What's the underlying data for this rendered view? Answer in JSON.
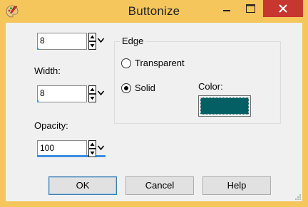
{
  "window": {
    "title": "Buttonize",
    "icons": {
      "app": "paint-palette-icon",
      "minimize": "minimize-icon",
      "maximize": "maximize-icon",
      "close": "close-icon"
    }
  },
  "top_field": {
    "value": "8",
    "fill_fraction": 0.02
  },
  "width_field": {
    "label": "Width:",
    "value": "8",
    "fill_fraction": 0.02
  },
  "opacity_field": {
    "label": "Opacity:",
    "value": "100",
    "fill_fraction": 1.0
  },
  "edge": {
    "group_label": "Edge",
    "options": [
      {
        "label": "Transparent",
        "selected": false
      },
      {
        "label": "Solid",
        "selected": true
      }
    ],
    "color_label": "Color:",
    "color": "#035f63"
  },
  "buttons": {
    "ok": "OK",
    "cancel": "Cancel",
    "help": "Help"
  },
  "colors": {
    "titlebar": "#f4c65c",
    "close": "#c7372f",
    "accent": "#3c8fe0"
  }
}
